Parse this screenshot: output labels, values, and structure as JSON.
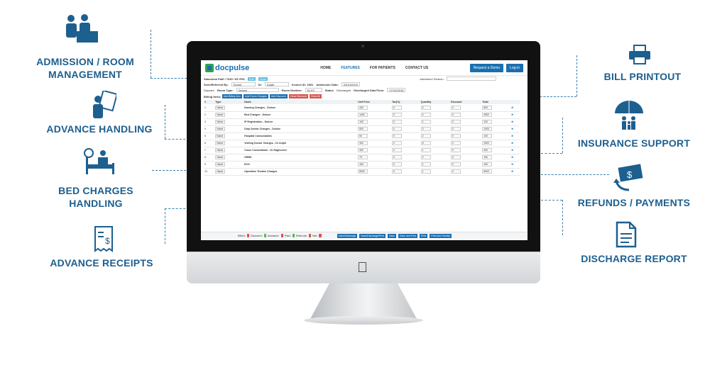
{
  "features_left": [
    {
      "label": "ADMISSION / ROOM\nMANAGEMENT",
      "icon": "admission-desk-icon"
    },
    {
      "label": "ADVANCE HANDLING",
      "icon": "patient-card-icon"
    },
    {
      "label": "BED CHARGES\nHANDLING",
      "icon": "hospital-bed-icon"
    },
    {
      "label": "ADVANCE RECEIPTS",
      "icon": "receipt-icon"
    }
  ],
  "features_right": [
    {
      "label": "BILL PRINTOUT",
      "icon": "printer-icon"
    },
    {
      "label": "INSURANCE SUPPORT",
      "icon": "umbrella-family-icon"
    },
    {
      "label": "REFUNDS / PAYMENTS",
      "icon": "money-refund-icon"
    },
    {
      "label": "DISCHARGE REPORT",
      "icon": "document-icon"
    }
  ],
  "app": {
    "logo": "docpulse",
    "nav": [
      "HOME",
      "FEATURES",
      "FOR PATIENTS",
      "CONTACT US"
    ],
    "request_demo": "Request a Demo",
    "login": "Log-in",
    "patient": "Sakumma Patil / 7040 / 65 YRS",
    "edit": "Edit",
    "clear": "Clear",
    "admission_reason": "Admission Reason",
    "seen_by_label": "Seen/Referred By:",
    "seen_by": "Doctor",
    "dr_label": "Dr.",
    "dr": "Anjali",
    "invoice": "Invoice ID: 2961",
    "admission_date_label": "Admission Date:",
    "admission_date": "03/10/2015",
    "daycare": "Daycare",
    "room_type_label": "Room Type:",
    "room_type": "Deluxe",
    "room_number_label": "Room Number:",
    "room_number": "DLX3",
    "status_label": "Status",
    "status": "Discharged",
    "discharged_label": "Discharged Date/Time:",
    "discharged_date": "07/10/2015",
    "billing_label": "Billing Items",
    "billing_buttons": [
      "Add Billing Item",
      "Add Room Charges",
      "Add Discount",
      "Clear Discount",
      "Clear All"
    ],
    "columns": [
      "#",
      "Type",
      "Name",
      "Unit Price",
      "Tax(%)",
      "Quantity",
      "Discount",
      "Total"
    ],
    "rows": [
      {
        "n": "1",
        "type": "Name",
        "name": "Nursing Charges - Deluxe",
        "price": "400",
        "tax": "0",
        "qty": "2",
        "disc": "0",
        "total": "800"
      },
      {
        "n": "2",
        "type": "Name",
        "name": "Bed Charges - Deluxe",
        "price": "1400",
        "tax": "0",
        "qty": "2",
        "disc": "0",
        "total": "2800"
      },
      {
        "n": "3",
        "type": "Name",
        "name": "IP Registration - Deluxe",
        "price": "100",
        "tax": "0",
        "qty": "1",
        "disc": "0",
        "total": "100"
      },
      {
        "n": "4",
        "type": "Name",
        "name": "Duty Doctor Charges - Deluxe",
        "price": "500",
        "tax": "0",
        "qty": "2",
        "disc": "0",
        "total": "1000"
      },
      {
        "n": "5",
        "type": "Name",
        "name": "Hospital Consumables",
        "price": "50",
        "tax": "0",
        "qty": "2",
        "disc": "0",
        "total": "100"
      },
      {
        "n": "6",
        "type": "Name",
        "name": "Visiting Doctor Charges - Dr Anjali",
        "price": "300",
        "tax": "0",
        "qty": "5",
        "disc": "0",
        "total": "1500"
      },
      {
        "n": "7",
        "type": "Name",
        "name": "Cross Consultation - Dr Raghuveer",
        "price": "300",
        "tax": "0",
        "qty": "1",
        "disc": "0",
        "total": "300"
      },
      {
        "n": "8",
        "type": "Name",
        "name": "GRBS",
        "price": "75",
        "tax": "0",
        "qty": "2",
        "disc": "0",
        "total": "150"
      },
      {
        "n": "9",
        "type": "Name",
        "name": "ECG",
        "price": "150",
        "tax": "0",
        "qty": "1",
        "disc": "0",
        "total": "150"
      },
      {
        "n": "10",
        "type": "Name",
        "name": "Operation Theatre Charges",
        "price": "8000",
        "tax": "0",
        "qty": "1",
        "disc": "0",
        "total": "8000"
      }
    ],
    "footer": {
      "billed": "Billed:",
      "discount": "Discount:",
      "advance": "Advance:",
      "paid": "Paid:",
      "refunds": "Refunds:",
      "net": "Net:",
      "buttons": [
        "Save/Discharge",
        "Save/Discharge/Print",
        "Save",
        "Save and Print",
        "Print",
        "Print Adv Receipt"
      ]
    }
  },
  "colors": {
    "accent": "#1d5f8f",
    "brand_blue": "#1a6fb0",
    "brand_green": "#2ea44f"
  }
}
